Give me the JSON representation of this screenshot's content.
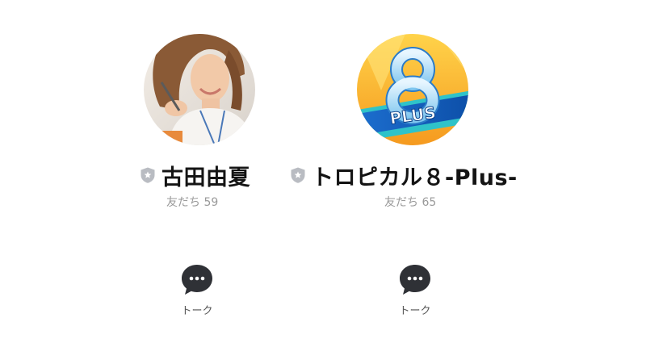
{
  "profiles": [
    {
      "name": "古田由夏",
      "friends_label": "友だち 59",
      "badge_icon": "shield-icon",
      "talk_label": "トーク"
    },
    {
      "name": "トロピカル８-Plus-",
      "friends_label": "友だち 65",
      "badge_icon": "shield-icon",
      "talk_label": "トーク",
      "logo_text": "PLUS"
    }
  ],
  "colors": {
    "text": "#141414",
    "sub_text": "#9a9a9a",
    "shield": "#b9bcc2",
    "bubble": "#2f3136"
  }
}
